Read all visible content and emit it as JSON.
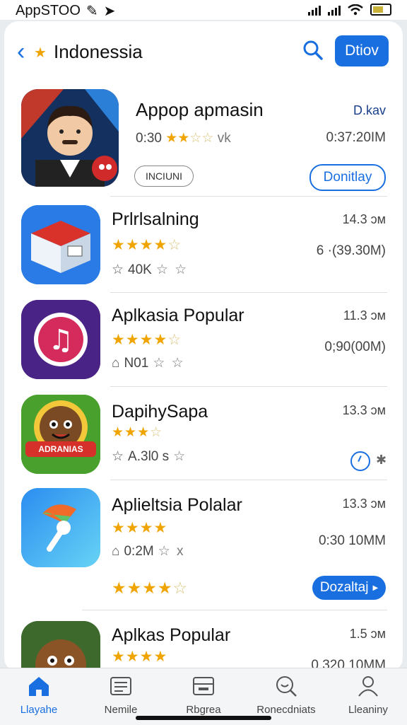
{
  "status_bar": {
    "left_text": "AppSTOO",
    "time_icons": [
      "edit-icon",
      "location-arrow-icon"
    ]
  },
  "header": {
    "title": "Indonessia",
    "button_label": "Dtiov"
  },
  "apps": [
    {
      "name": "Appop apmasin",
      "rating_text": "0:30",
      "rating_tail": "vk",
      "stars": 2,
      "right_top": "D.kav",
      "right_mid": "0:37:20IM",
      "tag": "INCIUNI",
      "action": "Donitlay",
      "action_style": "outline"
    },
    {
      "name": "Prlrlsalning",
      "stars": 4,
      "meta_text": "40K",
      "right_top": "14.3 ɔм",
      "right_mid": "6 ·(39.30M)"
    },
    {
      "name": "Aplkasia Popular",
      "stars": 4,
      "meta_text": "N01",
      "right_top": "11.3 ɔм",
      "right_mid": "0;90(00M)"
    },
    {
      "name": "DapihySapa",
      "stars": 3,
      "meta_text": "A.3l0 s",
      "right_top": "13.3 ɔм",
      "badge_text": "ADRANIAS"
    },
    {
      "name": "Aplieltsia Polalar",
      "stars": 4,
      "meta_text": "0:2M",
      "meta_tail": "x",
      "right_top": "13.3 ɔм",
      "right_mid": "0:30 10MM",
      "second_stars": 4,
      "action": "Dozaltaj",
      "action_style": "filled"
    },
    {
      "name": "Aplkas Popular",
      "stars": 4,
      "right_top": "1.5 ɔм",
      "right_mid": "0.320 10MM"
    }
  ],
  "tabs": [
    {
      "label": "Llayahe",
      "icon": "home-icon",
      "active": true
    },
    {
      "label": "Nemile",
      "icon": "list-icon",
      "active": false
    },
    {
      "label": "Rbgrea",
      "icon": "card-icon",
      "active": false
    },
    {
      "label": "Ronecdniats",
      "icon": "search-bubble-icon",
      "active": false
    },
    {
      "label": "Lleaniny",
      "icon": "person-icon",
      "active": false
    }
  ],
  "colors": {
    "accent": "#1a6fe0",
    "star": "#f0a400",
    "background": "#ffffff"
  }
}
